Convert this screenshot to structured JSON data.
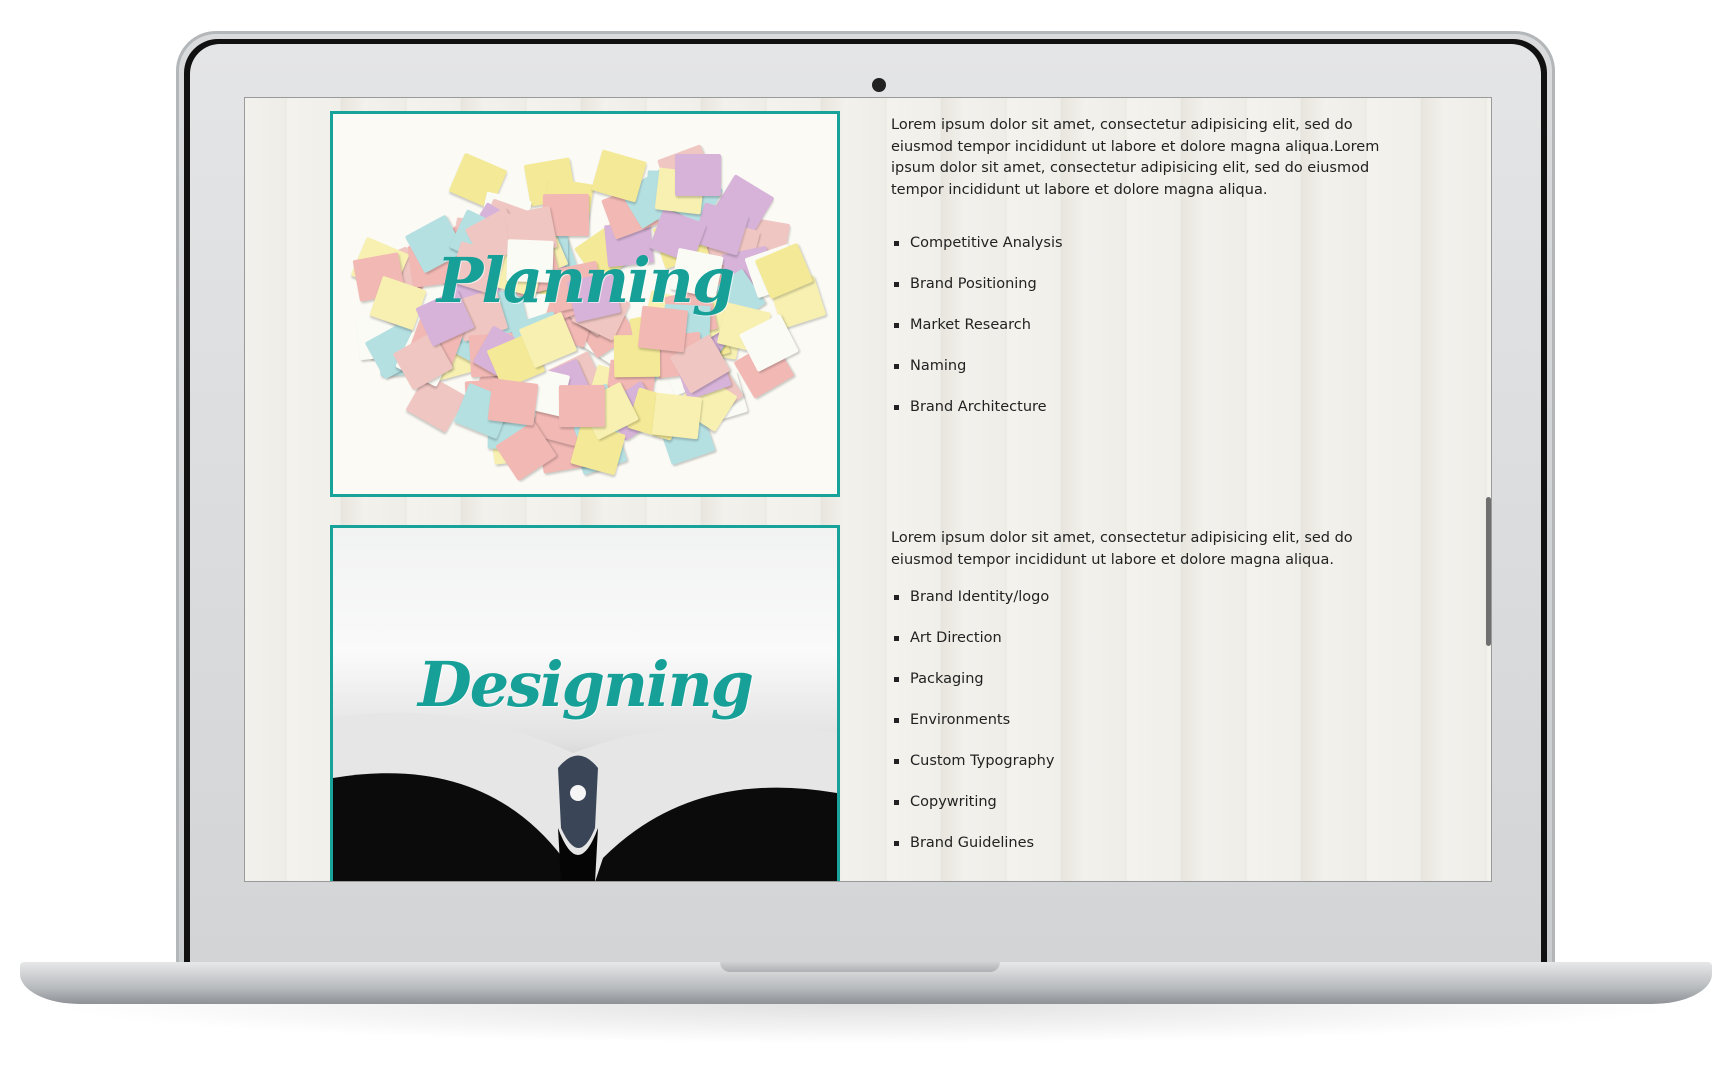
{
  "colors": {
    "accent": "#17a39a",
    "text": "#222222"
  },
  "sections": [
    {
      "title": "Planning",
      "paragraph": "Lorem ipsum dolor sit amet, consectetur adipisicing elit, sed do eiusmod tempor incididunt ut labore et dolore magna aliqua.Lorem ipsum dolor sit amet, consectetur adipisicing elit, sed do eiusmod tempor incididunt ut labore et dolore magna aliqua.",
      "items": [
        "Competitive Analysis",
        "Brand Positioning",
        "Market Research",
        "Naming",
        "Brand Architecture"
      ]
    },
    {
      "title": "Designing",
      "paragraph": "Lorem ipsum dolor sit amet, consectetur adipisicing elit, sed do eiusmod tempor incididunt ut labore et dolore magna aliqua.",
      "items": [
        "Brand Identity/logo",
        "Art Direction",
        "Packaging",
        "Environments",
        "Custom Typography",
        "Copywriting",
        "Brand Guidelines"
      ]
    }
  ]
}
